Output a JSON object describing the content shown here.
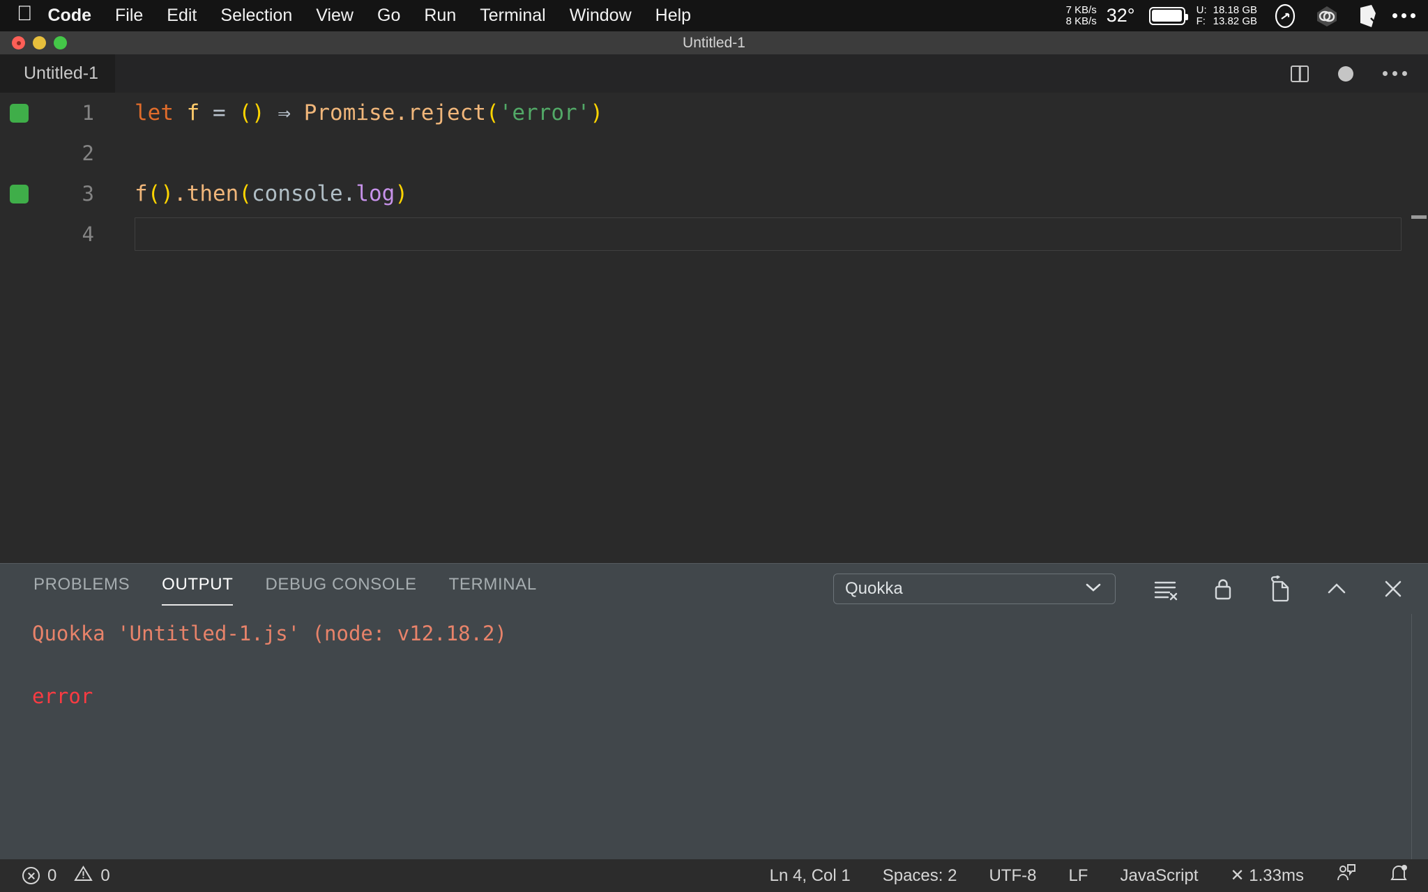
{
  "menubar": {
    "apple_icon": "apple-logo-icon",
    "items": [
      {
        "label": "Code",
        "bold": true
      },
      {
        "label": "File",
        "bold": false
      },
      {
        "label": "Edit",
        "bold": false
      },
      {
        "label": "Selection",
        "bold": false
      },
      {
        "label": "View",
        "bold": false
      },
      {
        "label": "Go",
        "bold": false
      },
      {
        "label": "Run",
        "bold": false
      },
      {
        "label": "Terminal",
        "bold": false
      },
      {
        "label": "Window",
        "bold": false
      },
      {
        "label": "Help",
        "bold": false
      }
    ],
    "status": {
      "net_up": "7 KB/s",
      "net_down": "8 KB/s",
      "temperature": "32°",
      "battery_icon": "battery-full-icon",
      "disk_used_label": "U:",
      "disk_free_label": "F:",
      "disk_used_value": "18.18 GB",
      "disk_free_value": "13.82 GB",
      "extra_icons": [
        "speedometer-icon",
        "bluetooth-link-icon",
        "quokka-icon",
        "control-center-dots-icon"
      ]
    }
  },
  "window": {
    "title": "Untitled-1"
  },
  "tabbar": {
    "tab_label": "Untitled-1",
    "actions": [
      "split-editor-icon",
      "unsaved-dot-icon",
      "more-actions-icon"
    ]
  },
  "editor": {
    "language": "javascript",
    "active_line": 4,
    "lines": [
      {
        "number": "1",
        "quokka_marker": true,
        "tokens": [
          {
            "t": "let",
            "c": "k-let"
          },
          {
            "t": " ",
            "c": "k-punc"
          },
          {
            "t": "f",
            "c": "k-var"
          },
          {
            "t": " ",
            "c": "k-punc"
          },
          {
            "t": "=",
            "c": "k-op"
          },
          {
            "t": " ",
            "c": "k-punc"
          },
          {
            "t": "()",
            "c": "k-paren"
          },
          {
            "t": " ",
            "c": "k-punc"
          },
          {
            "t": "⇒",
            "c": "k-arrow"
          },
          {
            "t": " ",
            "c": "k-punc"
          },
          {
            "t": "Promise",
            "c": "k-fn"
          },
          {
            "t": ".",
            "c": "k-fn"
          },
          {
            "t": "reject",
            "c": "k-fn"
          },
          {
            "t": "(",
            "c": "k-paren"
          },
          {
            "t": "'error'",
            "c": "k-str"
          },
          {
            "t": ")",
            "c": "k-paren"
          }
        ]
      },
      {
        "number": "2",
        "quokka_marker": false,
        "tokens": []
      },
      {
        "number": "3",
        "quokka_marker": true,
        "tokens": [
          {
            "t": "f",
            "c": "k-fn"
          },
          {
            "t": "()",
            "c": "k-paren"
          },
          {
            "t": ".",
            "c": "k-fn"
          },
          {
            "t": "then",
            "c": "k-fn"
          },
          {
            "t": "(",
            "c": "k-paren"
          },
          {
            "t": "console",
            "c": "k-obj"
          },
          {
            "t": ".",
            "c": "k-obj"
          },
          {
            "t": "log",
            "c": "k-prop"
          },
          {
            "t": ")",
            "c": "k-paren"
          }
        ]
      },
      {
        "number": "4",
        "quokka_marker": false,
        "tokens": []
      }
    ]
  },
  "panel": {
    "tabs": [
      {
        "label": "PROBLEMS",
        "active": false
      },
      {
        "label": "OUTPUT",
        "active": true
      },
      {
        "label": "DEBUG CONSOLE",
        "active": false
      },
      {
        "label": "TERMINAL",
        "active": false
      }
    ],
    "channel_select": {
      "value": "Quokka",
      "chevron_icon": "chevron-down-icon"
    },
    "actions": [
      "clear-output-icon",
      "lock-scroll-icon",
      "open-in-editor-icon",
      "maximize-panel-icon",
      "close-panel-icon"
    ],
    "output": {
      "header": "Quokka 'Untitled-1.js' (node: v12.18.2)",
      "error": "error"
    }
  },
  "statusbar": {
    "errors_icon": "error-circle-icon",
    "errors_count": "0",
    "warnings_icon": "warning-triangle-icon",
    "warnings_count": "0",
    "cursor_position": "Ln 4, Col 1",
    "indentation": "Spaces: 2",
    "encoding": "UTF-8",
    "eol": "LF",
    "language_mode": "JavaScript",
    "quokka_time": "✕ 1.33ms",
    "feedback_icon": "feedback-person-icon",
    "bell_icon": "notification-bell-icon"
  },
  "colors": {
    "menubar_bg": "#141414",
    "titlebar_bg": "#3c3c3c",
    "tabbar_bg": "#252526",
    "editor_bg": "#2a2a2a",
    "panel_bg": "#41474b",
    "statusbar_bg": "#2c2c2c",
    "quokka_green": "#3fae49",
    "output_header": "#e8836a",
    "output_error": "#fa3b42"
  }
}
